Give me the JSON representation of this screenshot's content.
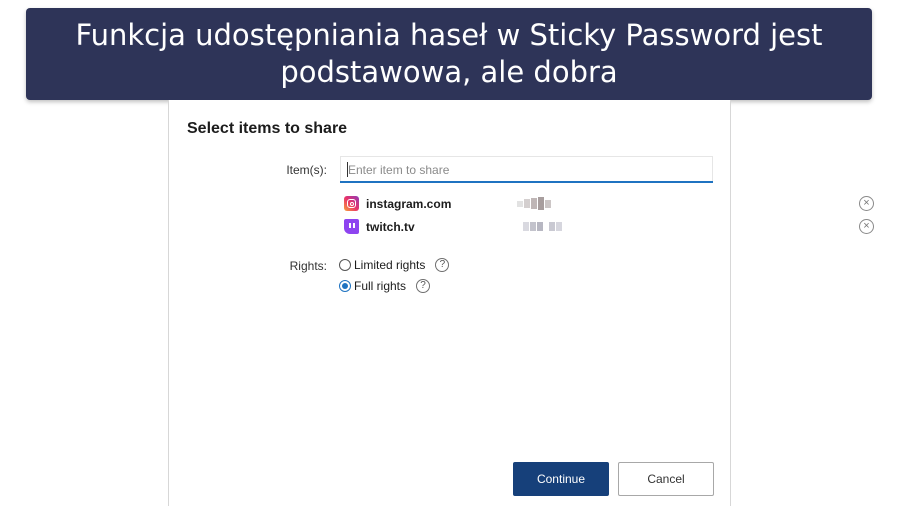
{
  "banner": {
    "text": "Funkcja udostępniania haseł w Sticky Password jest podstawowa, ale dobra"
  },
  "dialog": {
    "title": "Select items to share",
    "items_label": "Item(s):",
    "item_input": {
      "value": "",
      "placeholder": "Enter item to share"
    },
    "shared_items": [
      {
        "site": "instagram.com",
        "icon": "instagram-icon"
      },
      {
        "site": "twitch.tv",
        "icon": "twitch-icon"
      }
    ],
    "rights_label": "Rights:",
    "rights_options": [
      {
        "label": "Limited rights",
        "selected": false
      },
      {
        "label": "Full rights",
        "selected": true
      }
    ],
    "help_glyph": "?",
    "remove_glyph": "×",
    "buttons": {
      "continue": "Continue",
      "cancel": "Cancel"
    }
  },
  "colors": {
    "banner_bg": "#2e3458",
    "accent_blue": "#1f73c1",
    "continue_bg": "#16407a",
    "twitch_purple": "#8e44f0"
  }
}
